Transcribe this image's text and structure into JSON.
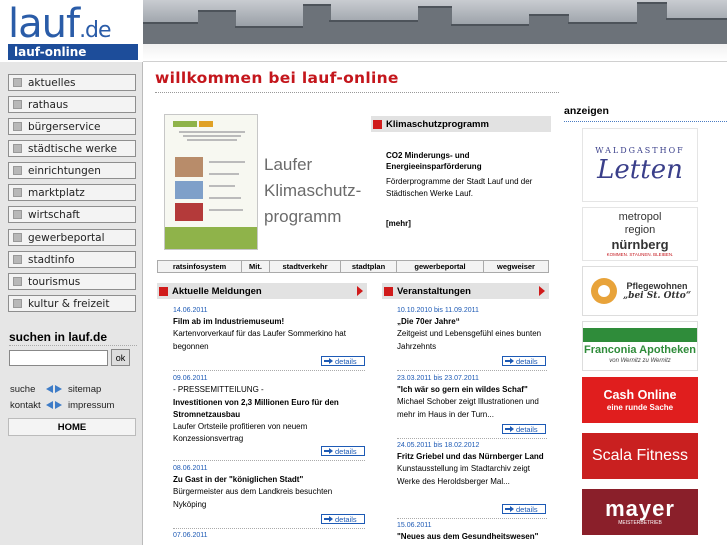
{
  "logo": {
    "main": "lauf",
    "tld": ".de",
    "sub": "lauf-online"
  },
  "nav": [
    "aktuelles",
    "rathaus",
    "bürgerservice",
    "städtische werke",
    "einrichtungen",
    "marktplatz",
    "wirtschaft",
    "gewerbeportal",
    "stadtinfo",
    "tourismus",
    "kultur & freizeit"
  ],
  "search": {
    "title": "suchen in lauf.de",
    "button": "ok",
    "value": ""
  },
  "util": {
    "suche": "suche",
    "sitemap": "sitemap",
    "kontakt": "kontakt",
    "impressum": "impressum"
  },
  "home": "HOME",
  "page_title": "willkommen bei lauf-online",
  "promo": {
    "caption_lines": [
      "Laufer",
      "Klimaschutz-",
      "programm"
    ]
  },
  "klima": {
    "heading": "Klimaschutzprogramm",
    "subtitle": "CO2 Minderungs- und Energieeinsparförderung",
    "text": "Förderprogramme der Stadt Lauf und der Städtischen Werke Lauf.",
    "more": "[mehr]"
  },
  "quicklinks": [
    "ratsinfosystem",
    "Mit.",
    "stadtverkehr",
    "stadtplan",
    "gewerbeportal",
    "wegweiser"
  ],
  "news": {
    "heading": "Aktuelle Meldungen",
    "details": "details",
    "items": [
      {
        "date": "14.06.2011",
        "title": "Film ab im Industriemuseum!",
        "body": "Kartenvorverkauf für das Laufer Sommerkino hat begonnen"
      },
      {
        "date": "09.06.2011",
        "pre": "- PRESSEMITTEILUNG -",
        "title": "Investitionen von 2,3 Millionen Euro für den Stromnetzausbau",
        "body": "Laufer Ortsteile profitieren von neuem Konzessionsvertrag"
      },
      {
        "date": "08.06.2011",
        "title": "Zu Gast in der \"königlichen Stadt\"",
        "body": "Bürgermeister aus dem Landkreis besuchten Nyköping"
      },
      {
        "date": "07.06.2011"
      }
    ]
  },
  "events": {
    "heading": "Veranstaltungen",
    "details": "details",
    "items": [
      {
        "date": "10.10.2010 bis 11.09.2011",
        "title": "„Die 70er Jahre“",
        "body": "Zeitgeist und Lebensgefühl eines bunten Jahrzehnts"
      },
      {
        "date": "23.03.2011 bis 23.07.2011",
        "title": "\"Ich wär so gern ein wildes Schaf\"",
        "body": "Michael Schober zeigt Illustrationen und mehr im Haus in der Turn..."
      },
      {
        "date": "24.05.2011 bis 18.02.2012",
        "title": "Fritz Griebel und das Nürnberger Land",
        "body": "Kunstausstellung im Stadtarchiv zeigt Werke des Heroldsberger Mal..."
      },
      {
        "date": "15.06.2011",
        "title": "\"Neues aus dem Gesundheitswesen\""
      }
    ]
  },
  "ads": {
    "title": "anzeigen",
    "items": [
      {
        "top": "WALDGASTHOF",
        "main": "Letten"
      },
      {
        "line1": "metropol",
        "line2": "region",
        "line3": "nürnberg",
        "sub": "KOMMEN. STAUNEN. BLEIBEN."
      },
      {
        "line1": "Pflegewohnen",
        "line2": "„bei St. Otto“"
      },
      {
        "line1": "Franconia Apotheken",
        "line2": "von Wernitz zu Wernitz"
      },
      {
        "line1": "Cash Online",
        "line2": "eine runde Sache"
      },
      {
        "line1": "Scala Fitness"
      },
      {
        "line1": "mayer",
        "line2": "MEISTERBETRIEB"
      }
    ]
  },
  "colors": {
    "accent_red": "#c4161c",
    "brand_blue": "#2a5ca8",
    "link_blue": "#1d5ab5"
  }
}
